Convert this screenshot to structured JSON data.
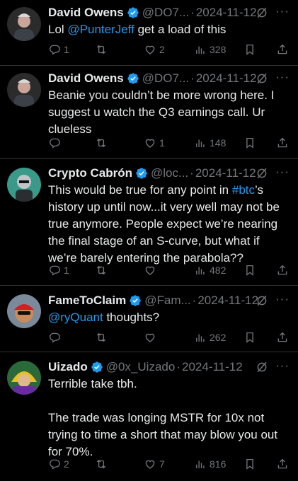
{
  "tweets": [
    {
      "name": "David Owens",
      "handle": "@DO7...",
      "date": "2024-11-12",
      "text_plain_before": "Lol ",
      "mention": "@PunterJeff",
      "text_plain_after": " get a load of this",
      "replies": "1",
      "retweets": "",
      "likes": "2",
      "views": "328"
    },
    {
      "name": "David Owens",
      "handle": "@DO7...",
      "date": "2024-11-12",
      "text": "Beanie you couldn’t be more wrong here. I suggest u watch the Q3 earnings call. Ur clueless",
      "replies": "",
      "retweets": "",
      "likes": "1",
      "views": "148"
    },
    {
      "name": "Crypto Cabrón",
      "handle": "@loc...",
      "date": "2024-11-12",
      "text_before": "This would be true for any point in ",
      "hashtag": "#btc",
      "text_after": "’s history up until now...it very well may not be true anymore. People expect we’re nearing the final stage of an S-curve, but what if we’re barely entering the parabola??",
      "replies": "1",
      "retweets": "",
      "likes": "",
      "views": "482"
    },
    {
      "name": "FameToClaim",
      "handle": "@Fam...",
      "date": "2024-11-12",
      "mention": "@ryQuant",
      "text_after": " thoughts?",
      "replies": "",
      "retweets": "",
      "likes": "",
      "views": "262"
    },
    {
      "name": "Uizado",
      "handle": "@0x_Uizado",
      "date": "2024-11-12",
      "text": "Terrible take tbh.\n\nThe trade was longing MSTR for 10x not trying to time a short that may blow you out for 70%.",
      "replies": "2",
      "retweets": "",
      "likes": "7",
      "views": "816"
    }
  ],
  "separator": "·",
  "more_glyph": "···",
  "colors": {
    "accent": "#1d9bf0",
    "muted": "#71767b",
    "text": "#e7e9ea",
    "divider": "#2f3336"
  }
}
